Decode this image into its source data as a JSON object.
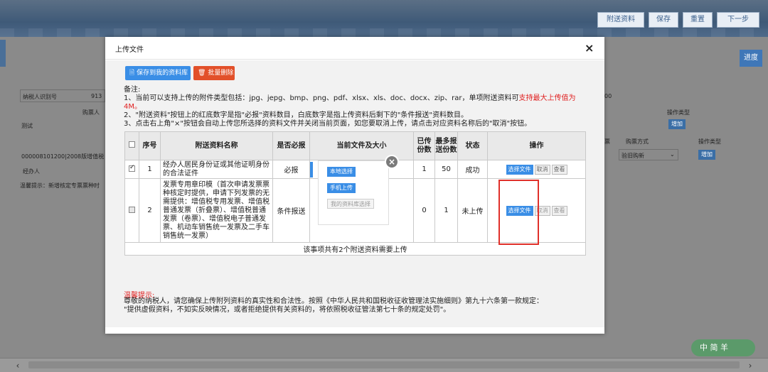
{
  "background": {
    "toolbar_buttons": [
      "附送资料",
      "保存",
      "重置",
      "下一步"
    ],
    "progress_label": "进度",
    "taxpayer_id_label": "纳税人识别号",
    "taxpayer_id_value_partial": "913",
    "buyer_label": "购票人",
    "test_value": "测试",
    "record_row": "000008101200|2008版增值税",
    "handler_label": "经办人",
    "hint_text": "温馨提示：新增核定专票票种时",
    "right_value_partial": "00",
    "op_type_label": "操作类型",
    "add_label": "增加",
    "tax_label_partial": "票",
    "purchase_method_label": "购票方式",
    "purchase_method_value": "验旧购新",
    "watermark_text": "中 简 羊"
  },
  "modal": {
    "title": "上传文件",
    "close_glyph": "×",
    "save_to_lib_label": "保存到我的资料库",
    "batch_delete_label": "批量删除",
    "notes": {
      "heading": "备注:",
      "line1_prefix": "1、当前可以支持上传的附件类型包括：jpg、jepg、bmp、png、pdf、xlsx、xls、doc、docx、zip、rar，单项附送资料可",
      "line1_red": "支持最大上传值为4M。",
      "line2": "2、\"附送资料\"按钮上的红底数字是指\"必报\"资料数目，白底数字是指上传资料后剩下的\"条件报送\"资料数目。",
      "line3": "3、点击右上角\"×\"按钮会自动上传您所选择的资料文件并关闭当前页面，如您要取消上传，请点击对应资料名称后的\"取消\"按钮。"
    },
    "table": {
      "headers": [
        "序号",
        "附送资料名称",
        "是否必报",
        "当前文件及大小",
        "已传份数",
        "最多报送份数",
        "状态",
        "操作"
      ],
      "rows": [
        {
          "index": "1",
          "name": "经办人居民身份证或其他证明身份的合法证件",
          "required": "必报",
          "uploaded": "1",
          "max": "50",
          "status": "成功",
          "op_select": "选择文件",
          "op_cancel": "取消",
          "op_view": "查看"
        },
        {
          "index": "2",
          "name": "发票专用章印模（首次申请发票票种核定时提供，申请下列发票的无需提供：增值税专用发票、增值税普通发票（折叠票）、增值税普通发票（卷票）、增值税电子普通发票、机动车销售统一发票及二手车销售统一发票）",
          "required": "条件报送",
          "uploaded": "0",
          "max": "1",
          "status": "未上传",
          "op_select": "选择文件",
          "op_cancel": "取消",
          "op_view": "查看"
        }
      ],
      "footer": "该事项共有2个附送资料需要上传"
    },
    "warm_title": "温馨提示:",
    "warm_line1": "尊敬的纳税人，请您确保上传附列资料的真实性和合法性。按照《中华人民共和国税收征收管理法实施细则》第九十六条第一款规定：",
    "warm_line2": "\"提供虚假资料，不如实反映情况，或者拒绝提供有关资料的，将依照税收征管法第七十条的规定处罚\"。"
  },
  "popup": {
    "local_label": "本地选择",
    "phone_label": "手机上传",
    "library_label": "我的资料库选择",
    "close_glyph": "×"
  },
  "colors": {
    "primary": "#3a8ee6",
    "danger": "#e2502a",
    "highlight": "#e0302a"
  }
}
